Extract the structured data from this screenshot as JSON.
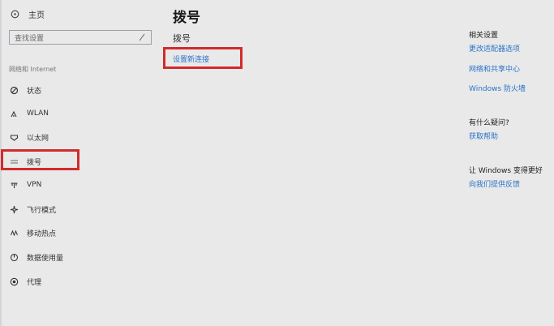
{
  "sidebar": {
    "home_label": "主页",
    "search_placeholder": "查找设置",
    "section_header": "网络和 Internet",
    "items": [
      {
        "label": "状态",
        "icon": "status-icon"
      },
      {
        "label": "WLAN",
        "icon": "wifi-icon"
      },
      {
        "label": "以太网",
        "icon": "ethernet-icon"
      },
      {
        "label": "拨号",
        "icon": "dialup-icon"
      },
      {
        "label": "VPN",
        "icon": "vpn-icon"
      },
      {
        "label": "飞行模式",
        "icon": "airplane-icon"
      },
      {
        "label": "移动热点",
        "icon": "hotspot-icon"
      },
      {
        "label": "数据使用量",
        "icon": "data-usage-icon"
      },
      {
        "label": "代理",
        "icon": "proxy-icon"
      }
    ]
  },
  "main": {
    "title": "拨号",
    "subtitle": "拨号",
    "setup_link": "设置新连接"
  },
  "related": {
    "heading": "相关设置",
    "links": [
      "更改适配器选项",
      "网络和共享中心",
      "Windows 防火墙"
    ],
    "help_heading": "有什么疑问?",
    "help_link": "获取帮助",
    "improve_heading": "让 Windows 变得更好",
    "improve_link": "向我们提供反馈"
  },
  "colors": {
    "accent": "#2b73c7",
    "highlight": "#d42a2a",
    "background": "#e9e9ea"
  }
}
